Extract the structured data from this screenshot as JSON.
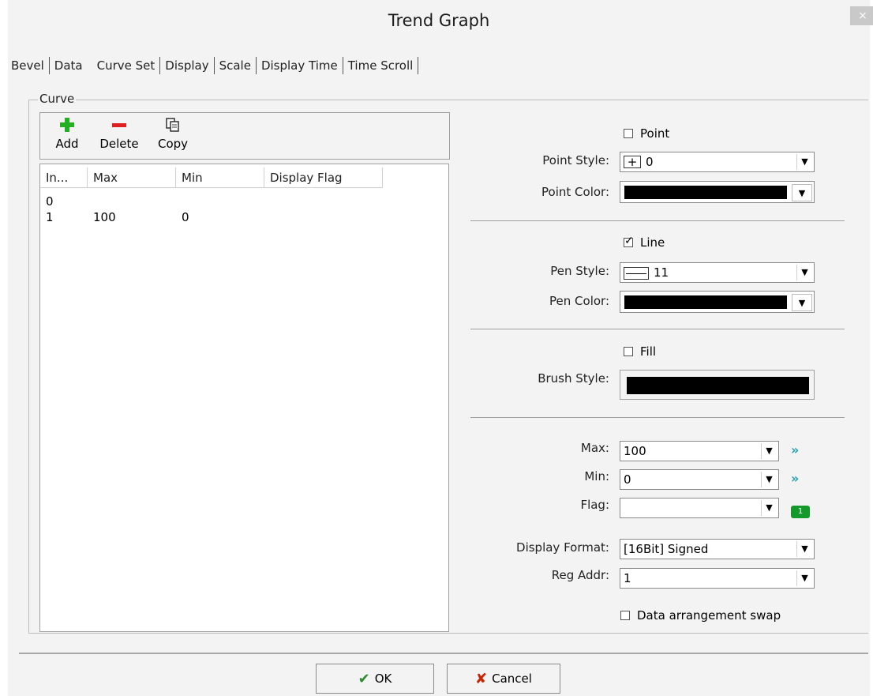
{
  "window": {
    "title": "Trend Graph",
    "close_glyph": "×"
  },
  "tabs": [
    "Bevel",
    "Data",
    "Curve Set",
    "Display",
    "Scale",
    "Display Time",
    "Time Scroll"
  ],
  "active_tab": "Curve Set",
  "curve_group": {
    "label": "Curve",
    "toolbar": {
      "add": "Add",
      "delete": "Delete",
      "copy": "Copy"
    },
    "columns": [
      "In...",
      "Max",
      "Min",
      "Display Flag"
    ],
    "rows": [
      {
        "index": "0",
        "max": "",
        "min": "",
        "flag": ""
      },
      {
        "index": "1",
        "max": "100",
        "min": "0",
        "flag": ""
      }
    ]
  },
  "point": {
    "checkbox_label": "Point",
    "checked": false,
    "style_label": "Point Style:",
    "style_value": "0",
    "style_glyph": "+",
    "color_label": "Point Color:",
    "color": "#000000"
  },
  "line": {
    "checkbox_label": "Line",
    "checked": true,
    "style_label": "Pen Style:",
    "style_value": "11",
    "color_label": "Pen Color:",
    "color": "#000000"
  },
  "fill": {
    "checkbox_label": "Fill",
    "checked": false,
    "brush_label": "Brush Style:",
    "color": "#000000"
  },
  "range": {
    "max_label": "Max:",
    "max_value": "100",
    "min_label": "Min:",
    "min_value": "0",
    "flag_label": "Flag:",
    "flag_value": "",
    "format_label": "Display Format:",
    "format_value": "[16Bit] Signed",
    "reg_label": "Reg Addr:",
    "reg_value": "1",
    "swap_label": "Data arrangement swap",
    "swap_checked": false,
    "go_glyph": "»",
    "bit_glyph": "1"
  },
  "buttons": {
    "ok": "OK",
    "cancel": "Cancel"
  },
  "colors": {
    "add_icon": "#22b022",
    "delete_icon": "#e02020",
    "ok_icon": "#2e8b2e",
    "cancel_icon": "#cc2200",
    "go_icon": "#20a0b0",
    "bit_icon": "#139a2a"
  }
}
